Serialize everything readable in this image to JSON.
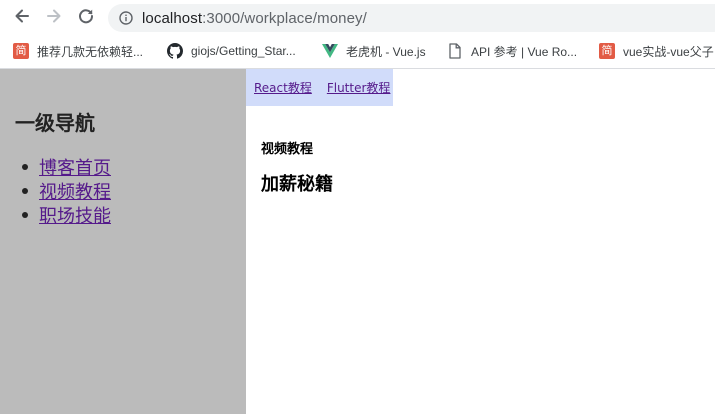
{
  "browser": {
    "url_host": "localhost",
    "url_path": ":3000/workplace/money/",
    "bookmarks": [
      {
        "label": "推荐几款无依赖轻...",
        "icon": "jian-icon",
        "icon_text": "简"
      },
      {
        "label": "giojs/Getting_Star...",
        "icon": "github-icon"
      },
      {
        "label": "老虎机 - Vue.js",
        "icon": "vue-icon"
      },
      {
        "label": "API 参考 | Vue Ro...",
        "icon": "document-icon"
      },
      {
        "label": "vue实战-vue父子",
        "icon": "jian-icon",
        "icon_text": "简"
      }
    ]
  },
  "sidebar": {
    "title": "一级导航",
    "items": [
      {
        "label": "博客首页"
      },
      {
        "label": "视频教程"
      },
      {
        "label": "职场技能"
      }
    ]
  },
  "tabs": [
    {
      "label": "React教程"
    },
    {
      "label": "Flutter教程"
    }
  ],
  "content": {
    "subtitle": "视频教程",
    "title": "加薪秘籍"
  },
  "colors": {
    "sidebar_bg": "#bbbbbb",
    "tabs_bg": "#d1dcfa",
    "link_visited": "#551a8b",
    "bookmark_icon_red": "#e25b45",
    "vue_green": "#41b883",
    "vue_dark": "#35495e"
  }
}
